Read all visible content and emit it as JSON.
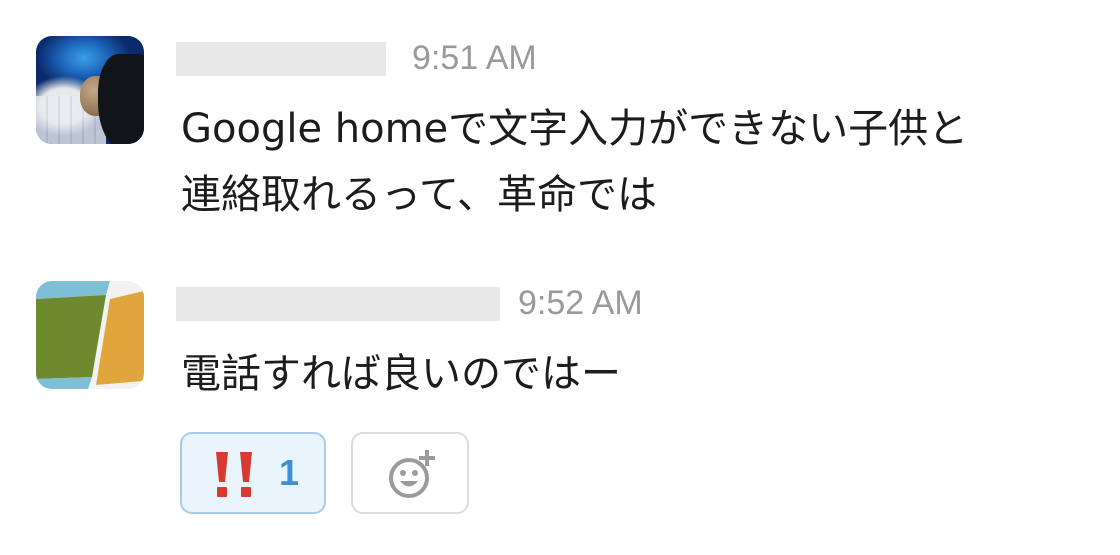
{
  "messages": [
    {
      "avatar_icon": "user-photo-avatar",
      "timestamp": "9:51 AM",
      "text": "Google homeで文字入力ができない子供と\n連絡取れるって、革命では"
    },
    {
      "avatar_icon": "tile-avatar",
      "timestamp": "9:52 AM",
      "text": "電話すれば良いのではー",
      "reactions": [
        {
          "emoji_icon": "double-exclamation-icon",
          "count": "1"
        }
      ],
      "add_reaction_icon": "add-emoji-icon"
    }
  ],
  "colors": {
    "timestamp": "#9a9a9a",
    "reaction_active_bg": "#eaf4fd",
    "reaction_active_border": "#a7cbe9",
    "reaction_count": "#3a8fd6",
    "exclamation_red": "#d73a31",
    "avatar_green": "#6f8a2e",
    "avatar_orange": "#e0a63c",
    "avatar_blue": "#7fbfd6"
  }
}
